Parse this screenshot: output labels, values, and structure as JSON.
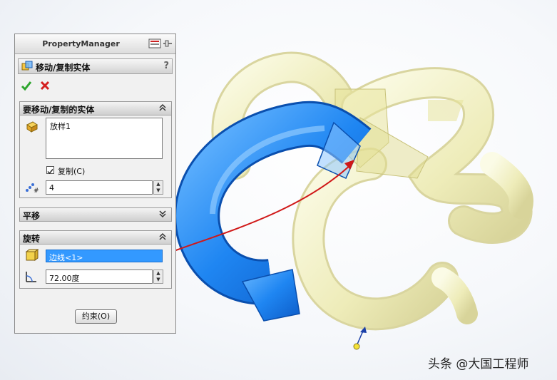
{
  "panel": {
    "title": "PropertyManager",
    "feature_title": "移动/复制实体",
    "help_label": "?"
  },
  "bodies_group": {
    "title": "要移动/复制的实体",
    "items": [
      "放样1"
    ],
    "copy_label": "复制(C)",
    "copy_checked": true,
    "count_value": "4"
  },
  "translate_group": {
    "title": "平移"
  },
  "rotate_group": {
    "title": "旋转",
    "edge_value": "边线<1>",
    "angle_value": "72.00度"
  },
  "constraint_button": "约束(O)",
  "watermark": "头条 @大国工程师",
  "colors": {
    "selected_body": "#2a86f0",
    "ghost_body": "#f2f0c0",
    "highlight": "#3399ff",
    "arrow": "#d01818"
  },
  "icons": [
    "move-copy-icon",
    "help-icon",
    "ok-icon",
    "cancel-icon",
    "bodies-icon",
    "count-icon",
    "edge-icon",
    "angle-icon",
    "pushpin-icon"
  ]
}
